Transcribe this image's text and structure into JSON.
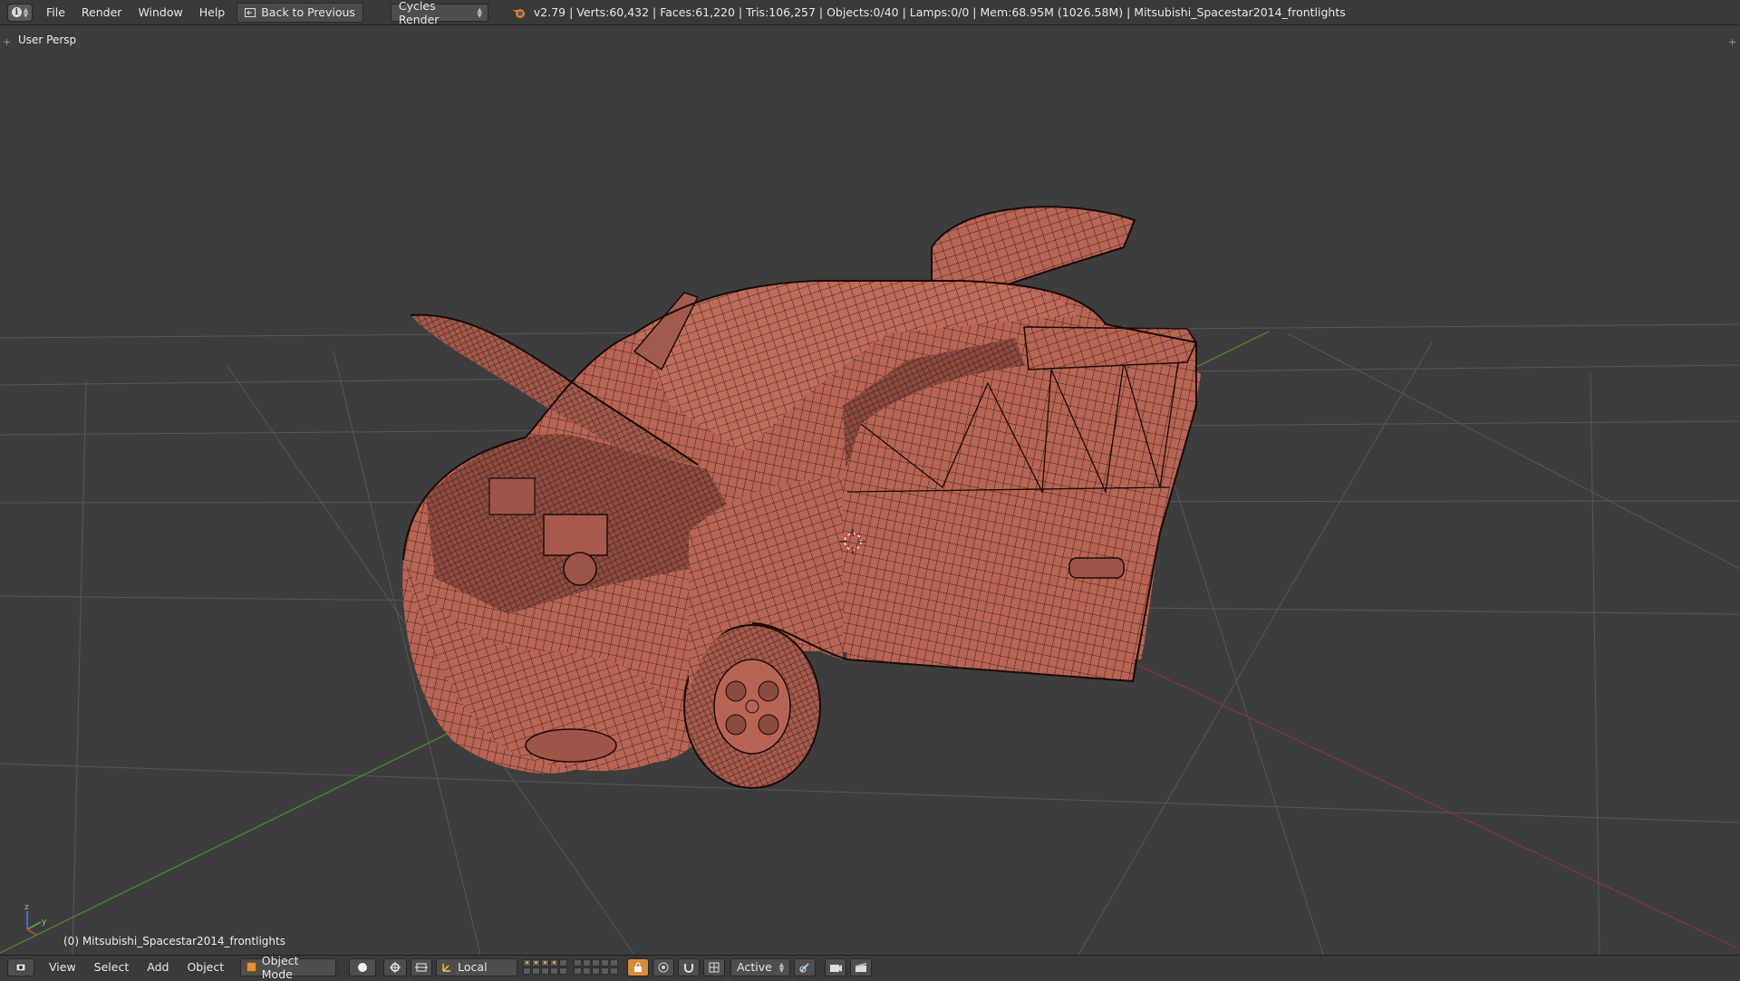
{
  "topbar": {
    "menus": [
      "File",
      "Render",
      "Window",
      "Help"
    ],
    "back_label": "Back to Previous",
    "render_engine": "Cycles Render",
    "stats": "v2.79 | Verts:60,432 | Faces:61,220 | Tris:106,257 | Objects:0/40 | Lamps:0/0 | Mem:68.95M (1026.58M) | Mitsubishi_Spacestar2014_frontlights"
  },
  "viewport": {
    "view_label": "User Persp",
    "object_label": "(0) Mitsubishi_Spacestar2014_frontlights",
    "axis_labels": {
      "z": "z",
      "y": "y"
    }
  },
  "bottombar": {
    "menus": [
      "View",
      "Select",
      "Add",
      "Object"
    ],
    "mode": "Object Mode",
    "orientation": "Local",
    "snap_target": "Active"
  },
  "icons": {
    "info": "info-icon",
    "back": "back-icon",
    "blender": "blender-logo-icon",
    "mode": "cube-icon",
    "shading": "sphere-shading-icon",
    "pivot": "pivot-icon",
    "manipulator": "manipulator-icon",
    "lock": "lock-layer-icon",
    "proportional": "proportional-edit-icon",
    "snap": "magnet-icon",
    "render_view": "camera-icon",
    "render_anim": "clapperboard-icon"
  },
  "colors": {
    "model": "#b86454",
    "wire": "#1a0c0a",
    "grid": "#575757",
    "x_axis": "#8a3535",
    "y_axis": "#4d8a38"
  }
}
